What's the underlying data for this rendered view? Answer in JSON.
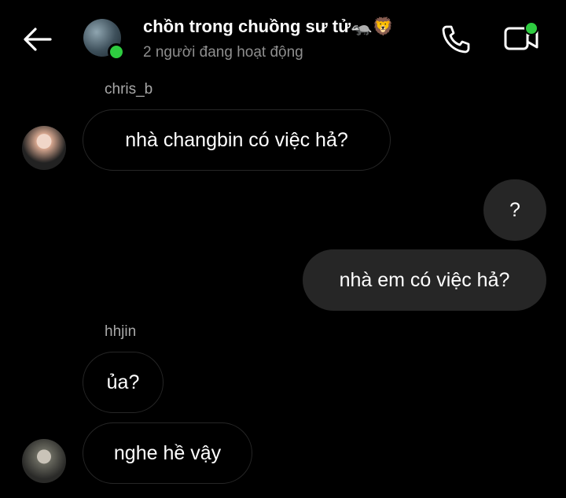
{
  "header": {
    "title": "chồn trong chuồng sư tử🦡🦁",
    "status": "2 người đang hoạt động"
  },
  "messages": [
    {
      "sender": "chris_b",
      "text": "nhà changbin có việc hả?"
    },
    {
      "text": "?"
    },
    {
      "text": "nhà em có việc hả?"
    },
    {
      "sender": "hhjin",
      "text": "ủa?"
    },
    {
      "text": "nghe hề vậy"
    }
  ],
  "colors": {
    "background": "#000000",
    "outgoing_bubble": "#262626",
    "online": "#2ecc40",
    "secondary_text": "#8e8e8e"
  }
}
